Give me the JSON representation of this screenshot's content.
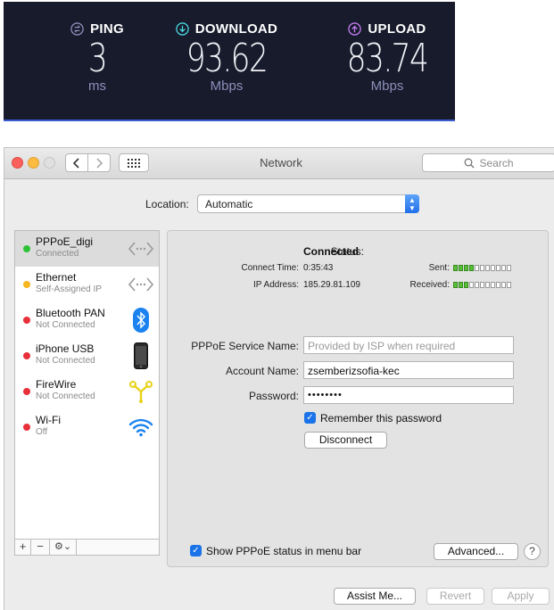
{
  "speedtest": {
    "ping": {
      "label": "PING",
      "value": "3",
      "unit": "ms",
      "icon": "ping-icon"
    },
    "download": {
      "label": "DOWNLOAD",
      "value": "93.62",
      "unit": "Mbps",
      "icon": "download-icon"
    },
    "upload": {
      "label": "UPLOAD",
      "value": "83.74",
      "unit": "Mbps",
      "icon": "upload-icon"
    },
    "colors": {
      "ping": "#8b90b8",
      "download": "#4ad8e0",
      "upload": "#c47cf0",
      "background": "#181b2c"
    }
  },
  "window": {
    "title": "Network",
    "search_placeholder": "Search",
    "location_label": "Location:",
    "location_value": "Automatic"
  },
  "services": [
    {
      "name": "PPPoE_digi",
      "status": "Connected",
      "color": "#2ec336",
      "icon": "ethernet-arrows-icon",
      "selected": true
    },
    {
      "name": "Ethernet",
      "status": "Self-Assigned IP",
      "color": "#f5b621",
      "icon": "ethernet-arrows-icon"
    },
    {
      "name": "Bluetooth PAN",
      "status": "Not Connected",
      "color": "#e8303a",
      "icon": "bluetooth-icon"
    },
    {
      "name": "iPhone USB",
      "status": "Not Connected",
      "color": "#e8303a",
      "icon": "iphone-icon"
    },
    {
      "name": "FireWire",
      "status": "Not Connected",
      "color": "#e8303a",
      "icon": "firewire-icon"
    },
    {
      "name": "Wi-Fi",
      "status": "Off",
      "color": "#e8303a",
      "icon": "wifi-icon"
    }
  ],
  "sidebar_tools": {
    "add": "+",
    "remove": "−",
    "gear": "⚙⌄"
  },
  "detail": {
    "status_label": "Status:",
    "status_value": "Connected",
    "connect_time_label": "Connect Time:",
    "connect_time_value": "0:35:43",
    "ip_label": "IP Address:",
    "ip_value": "185.29.81.109",
    "sent_label": "Sent:",
    "received_label": "Received:",
    "sent_level": 4,
    "received_level": 3,
    "meter_segments": 11,
    "service_name_label": "PPPoE Service Name:",
    "service_name_placeholder": "Provided by ISP when required",
    "account_label": "Account Name:",
    "account_value": "zsemberizsofia-kec",
    "password_label": "Password:",
    "password_value": "••••••••",
    "remember_label": "Remember this password",
    "disconnect_label": "Disconnect",
    "show_status_label": "Show PPPoE status in menu bar",
    "advanced_label": "Advanced...",
    "help_label": "?"
  },
  "footer": {
    "assist_label": "Assist Me...",
    "revert_label": "Revert",
    "apply_label": "Apply"
  }
}
